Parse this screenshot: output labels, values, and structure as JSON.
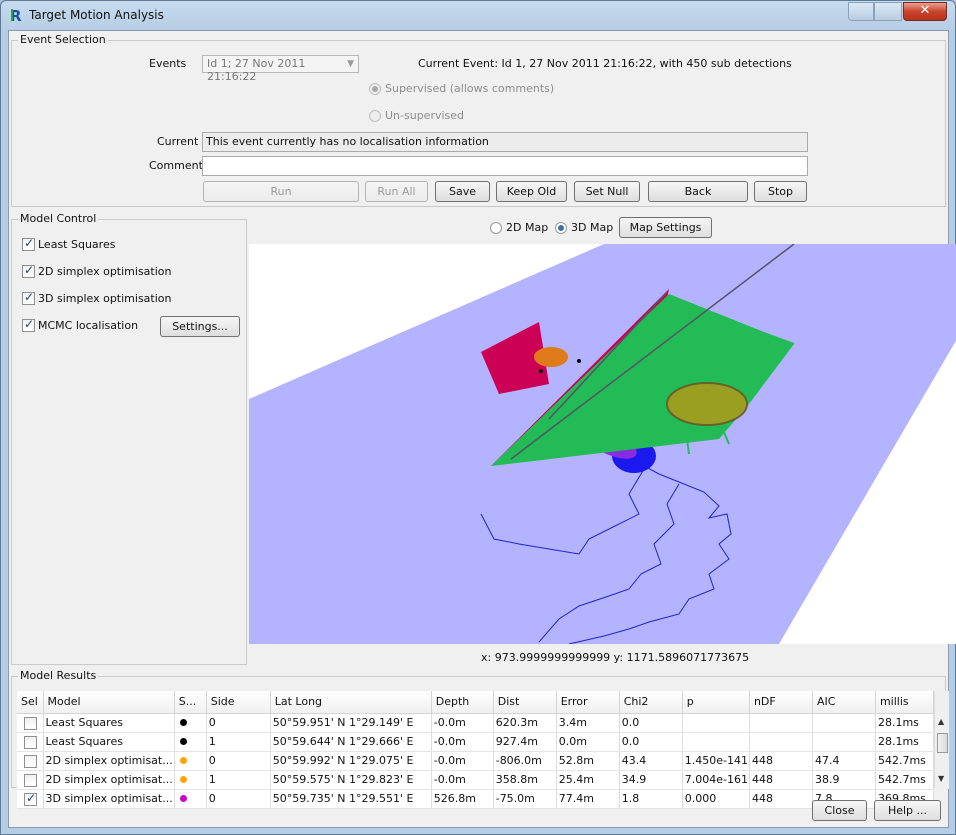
{
  "window": {
    "title": "Target Motion Analysis",
    "close_glyph": "✕"
  },
  "event_selection": {
    "group_label": "Event Selection",
    "events_label": "Events",
    "events_value": "Id 1; 27 Nov 2011 21:16:22",
    "current_event_text": "Current Event: Id 1, 27 Nov 2011 21:16:22, with 450 sub detections",
    "supervised_label": "Supervised (allows comments)",
    "unsupervised_label": "Un-supervised",
    "current_label": "Current",
    "current_value": "This event currently has no localisation information",
    "comment_label": "Comment",
    "comment_value": "",
    "buttons": {
      "run": "Run",
      "run_all": "Run All",
      "save": "Save",
      "keep_old": "Keep Old",
      "set_null": "Set Null",
      "back": "Back",
      "stop": "Stop"
    }
  },
  "model_control": {
    "group_label": "Model Control",
    "items": [
      {
        "label": "Least Squares",
        "checked": true
      },
      {
        "label": "2D simplex optimisation",
        "checked": true
      },
      {
        "label": "3D simplex optimisation",
        "checked": true
      },
      {
        "label": "MCMC localisation",
        "checked": true
      }
    ],
    "settings_button": "Settings..."
  },
  "map": {
    "option_2d": "2D Map",
    "option_3d": "3D Map",
    "selected": "3D Map",
    "settings_button": "Map Settings",
    "coords_text": "x: 973.9999999999999 y: 1171.5896071773675",
    "plane_color": "#b3b3ff"
  },
  "results": {
    "group_label": "Model Results",
    "columns": [
      "Sel",
      "Model",
      "S...",
      "Side",
      "Lat Long",
      "Depth",
      "Dist",
      "Error",
      "Chi2",
      "p",
      "nDF",
      "AIC",
      "millis"
    ],
    "rows": [
      {
        "sel": false,
        "model": "Least Squares",
        "color": "#000000",
        "side": "0",
        "latlong": "50°59.951' N   1°29.149' E",
        "depth": "-0.0m",
        "dist": "620.3m",
        "error": "3.4m",
        "chi2": "0.0",
        "p": "",
        "ndf": "",
        "aic": "",
        "millis": "28.1ms"
      },
      {
        "sel": false,
        "model": "Least Squares",
        "color": "#000000",
        "side": "1",
        "latlong": "50°59.644' N   1°29.666' E",
        "depth": "-0.0m",
        "dist": "927.4m",
        "error": "0.0m",
        "chi2": "0.0",
        "p": "",
        "ndf": "",
        "aic": "",
        "millis": "28.1ms"
      },
      {
        "sel": false,
        "model": "2D simplex optimisat...",
        "color": "#ffa500",
        "side": "0",
        "latlong": "50°59.992' N   1°29.075' E",
        "depth": "-0.0m",
        "dist": "-806.0m",
        "error": "52.8m",
        "chi2": "43.4",
        "p": "1.450e-141",
        "ndf": "448",
        "aic": "47.4",
        "millis": "542.7ms"
      },
      {
        "sel": false,
        "model": "2D simplex optimisat...",
        "color": "#ffa500",
        "side": "1",
        "latlong": "50°59.575' N   1°29.823' E",
        "depth": "-0.0m",
        "dist": "358.8m",
        "error": "25.4m",
        "chi2": "34.9",
        "p": "7.004e-161",
        "ndf": "448",
        "aic": "38.9",
        "millis": "542.7ms"
      },
      {
        "sel": true,
        "model": "3D simplex optimisat...",
        "color": "#cc00cc",
        "side": "0",
        "latlong": "50°59.735' N   1°29.551' E",
        "depth": "526.8m",
        "dist": "-75.0m",
        "error": "77.4m",
        "chi2": "1.8",
        "p": "0.000",
        "ndf": "448",
        "aic": "7.8",
        "millis": "369.8ms"
      }
    ]
  },
  "footer": {
    "close": "Close",
    "help": "Help ..."
  }
}
